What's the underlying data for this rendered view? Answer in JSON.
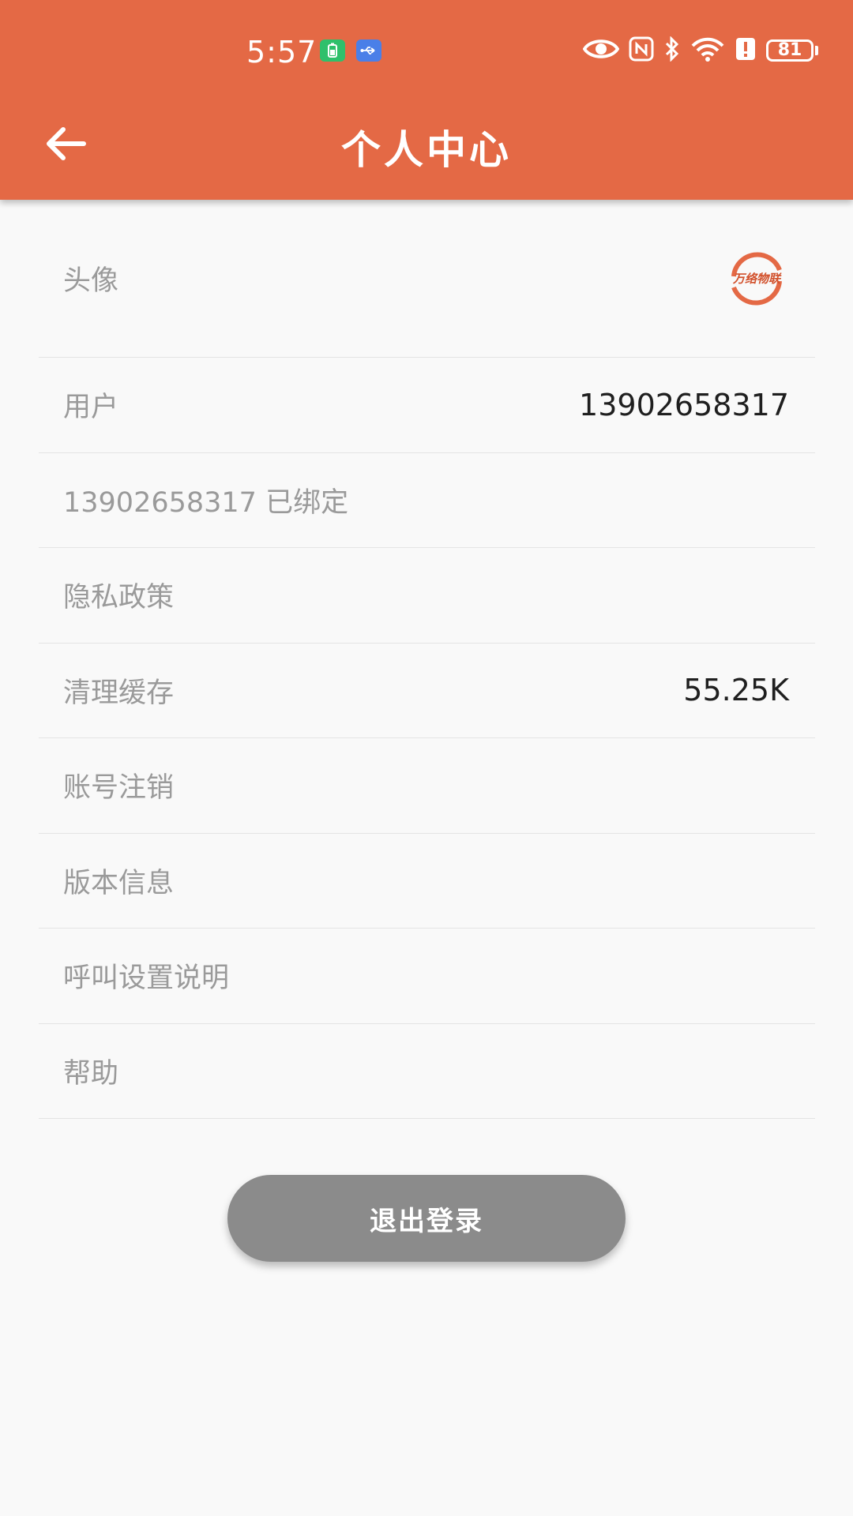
{
  "status_bar": {
    "time": "5:57",
    "battery_level": "81"
  },
  "header": {
    "title": "个人中心"
  },
  "profile": {
    "avatar": {
      "label": "头像",
      "logo_text": "万络物联"
    },
    "user": {
      "label": "用户",
      "value": "13902658317"
    },
    "binding": {
      "label": "13902658317 已绑定"
    },
    "privacy": {
      "label": "隐私政策"
    },
    "cache": {
      "label": "清理缓存",
      "value": "55.25K"
    },
    "account_cancel": {
      "label": "账号注销"
    },
    "version": {
      "label": "版本信息"
    },
    "call_settings": {
      "label": "呼叫设置说明"
    },
    "help": {
      "label": "帮助"
    }
  },
  "actions": {
    "logout_label": "退出登录"
  },
  "colors": {
    "primary": "#e46945",
    "background": "#f9f9f9",
    "logout_button": "#8b8b8b",
    "label_text": "#9a9a9a",
    "value_text": "#1f1f1f"
  }
}
